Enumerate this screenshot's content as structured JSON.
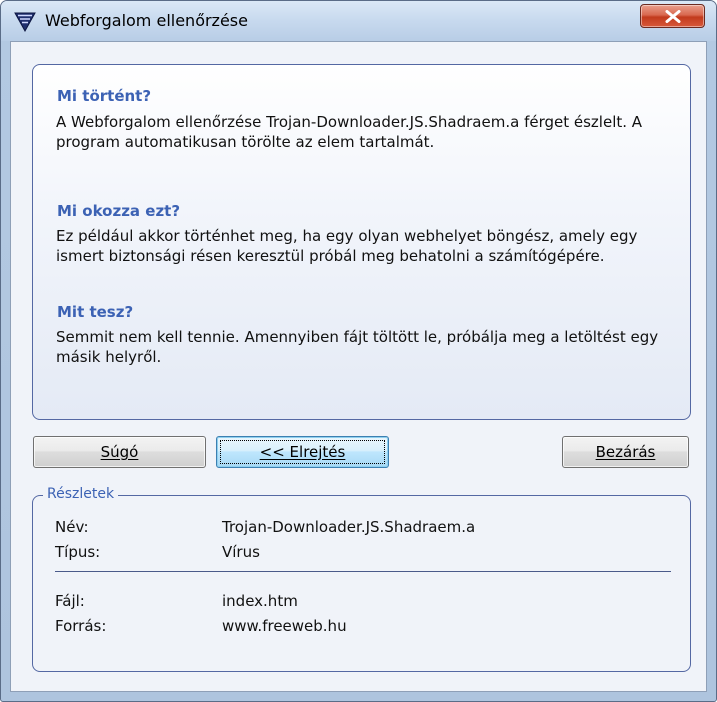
{
  "window": {
    "title": "Webforgalom ellenőrzése"
  },
  "info": {
    "sections": [
      {
        "heading": "Mi történt?",
        "lines": [
          "A Webforgalom ellenőrzése Trojan-Downloader.JS.Shadraem.a férget észlelt. A",
          "program automatikusan törölte az elem tartalmát."
        ]
      },
      {
        "heading": "Mi okozza ezt?",
        "lines": [
          "Ez például akkor történhet meg, ha egy olyan webhelyet böngész, amely egy",
          "ismert biztonsági résen keresztül próbál meg behatolni a számítógépére."
        ]
      },
      {
        "heading": "Mit tesz?",
        "lines": [
          "Semmit nem kell tennie. Amennyiben fájt töltött le, próbálja meg a letöltést egy",
          "másik helyről."
        ]
      }
    ]
  },
  "buttons": {
    "help": "Súgó",
    "hide": "<< Elrejtés",
    "close": "Bezárás"
  },
  "details": {
    "legend": "Részletek",
    "rows": [
      {
        "label": "Név:",
        "value": "Trojan-Downloader.JS.Shadraem.a"
      },
      {
        "label": "Típus:",
        "value": "Vírus"
      },
      {
        "label": "Fájl:",
        "value": "index.htm"
      },
      {
        "label": "Forrás:",
        "value": "www.freeweb.hu"
      }
    ]
  },
  "colors": {
    "heading": "#3c62b4",
    "panel_border": "#5468a3",
    "close_button": "#c23b1d"
  },
  "icons": {
    "app": "kaspersky-shield-icon",
    "close": "close-icon"
  }
}
